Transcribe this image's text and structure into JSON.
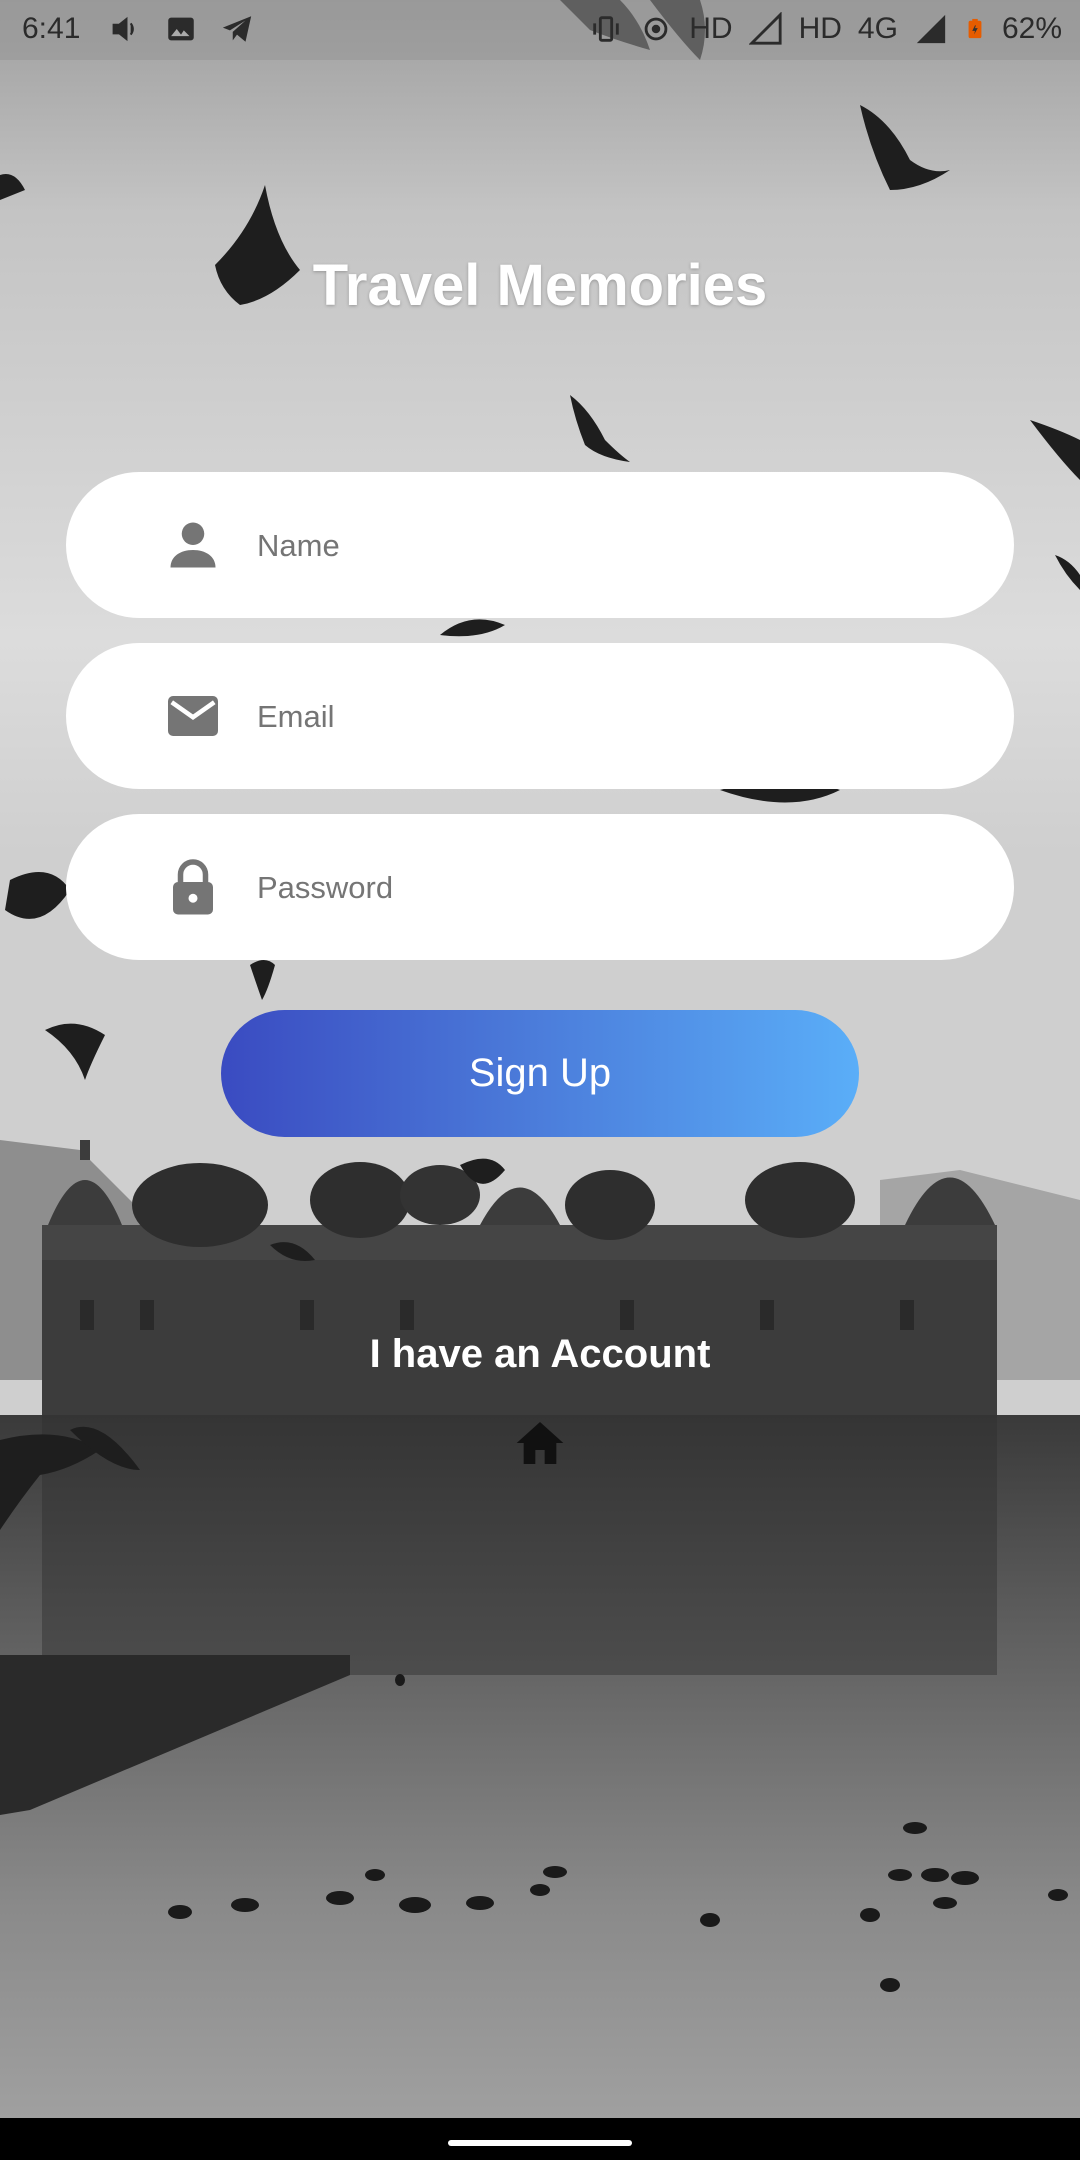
{
  "status_bar": {
    "time": "6:41",
    "network_hd_1": "HD",
    "network_hd_2": "HD",
    "network_type": "4G",
    "battery": "62%"
  },
  "app": {
    "title": "Travel Memories"
  },
  "form": {
    "name_placeholder": "Name",
    "email_placeholder": "Email",
    "password_placeholder": "Password",
    "signup_label": "Sign Up",
    "account_link": "I have an Account"
  },
  "icons": {
    "name": "person-icon",
    "email": "mail-icon",
    "password": "lock-icon",
    "home": "home-icon"
  },
  "colors": {
    "button_gradient_start": "#3a4bc1",
    "button_gradient_end": "#5aaef8",
    "field_background": "#ffffff",
    "icon_gray": "#757575"
  }
}
